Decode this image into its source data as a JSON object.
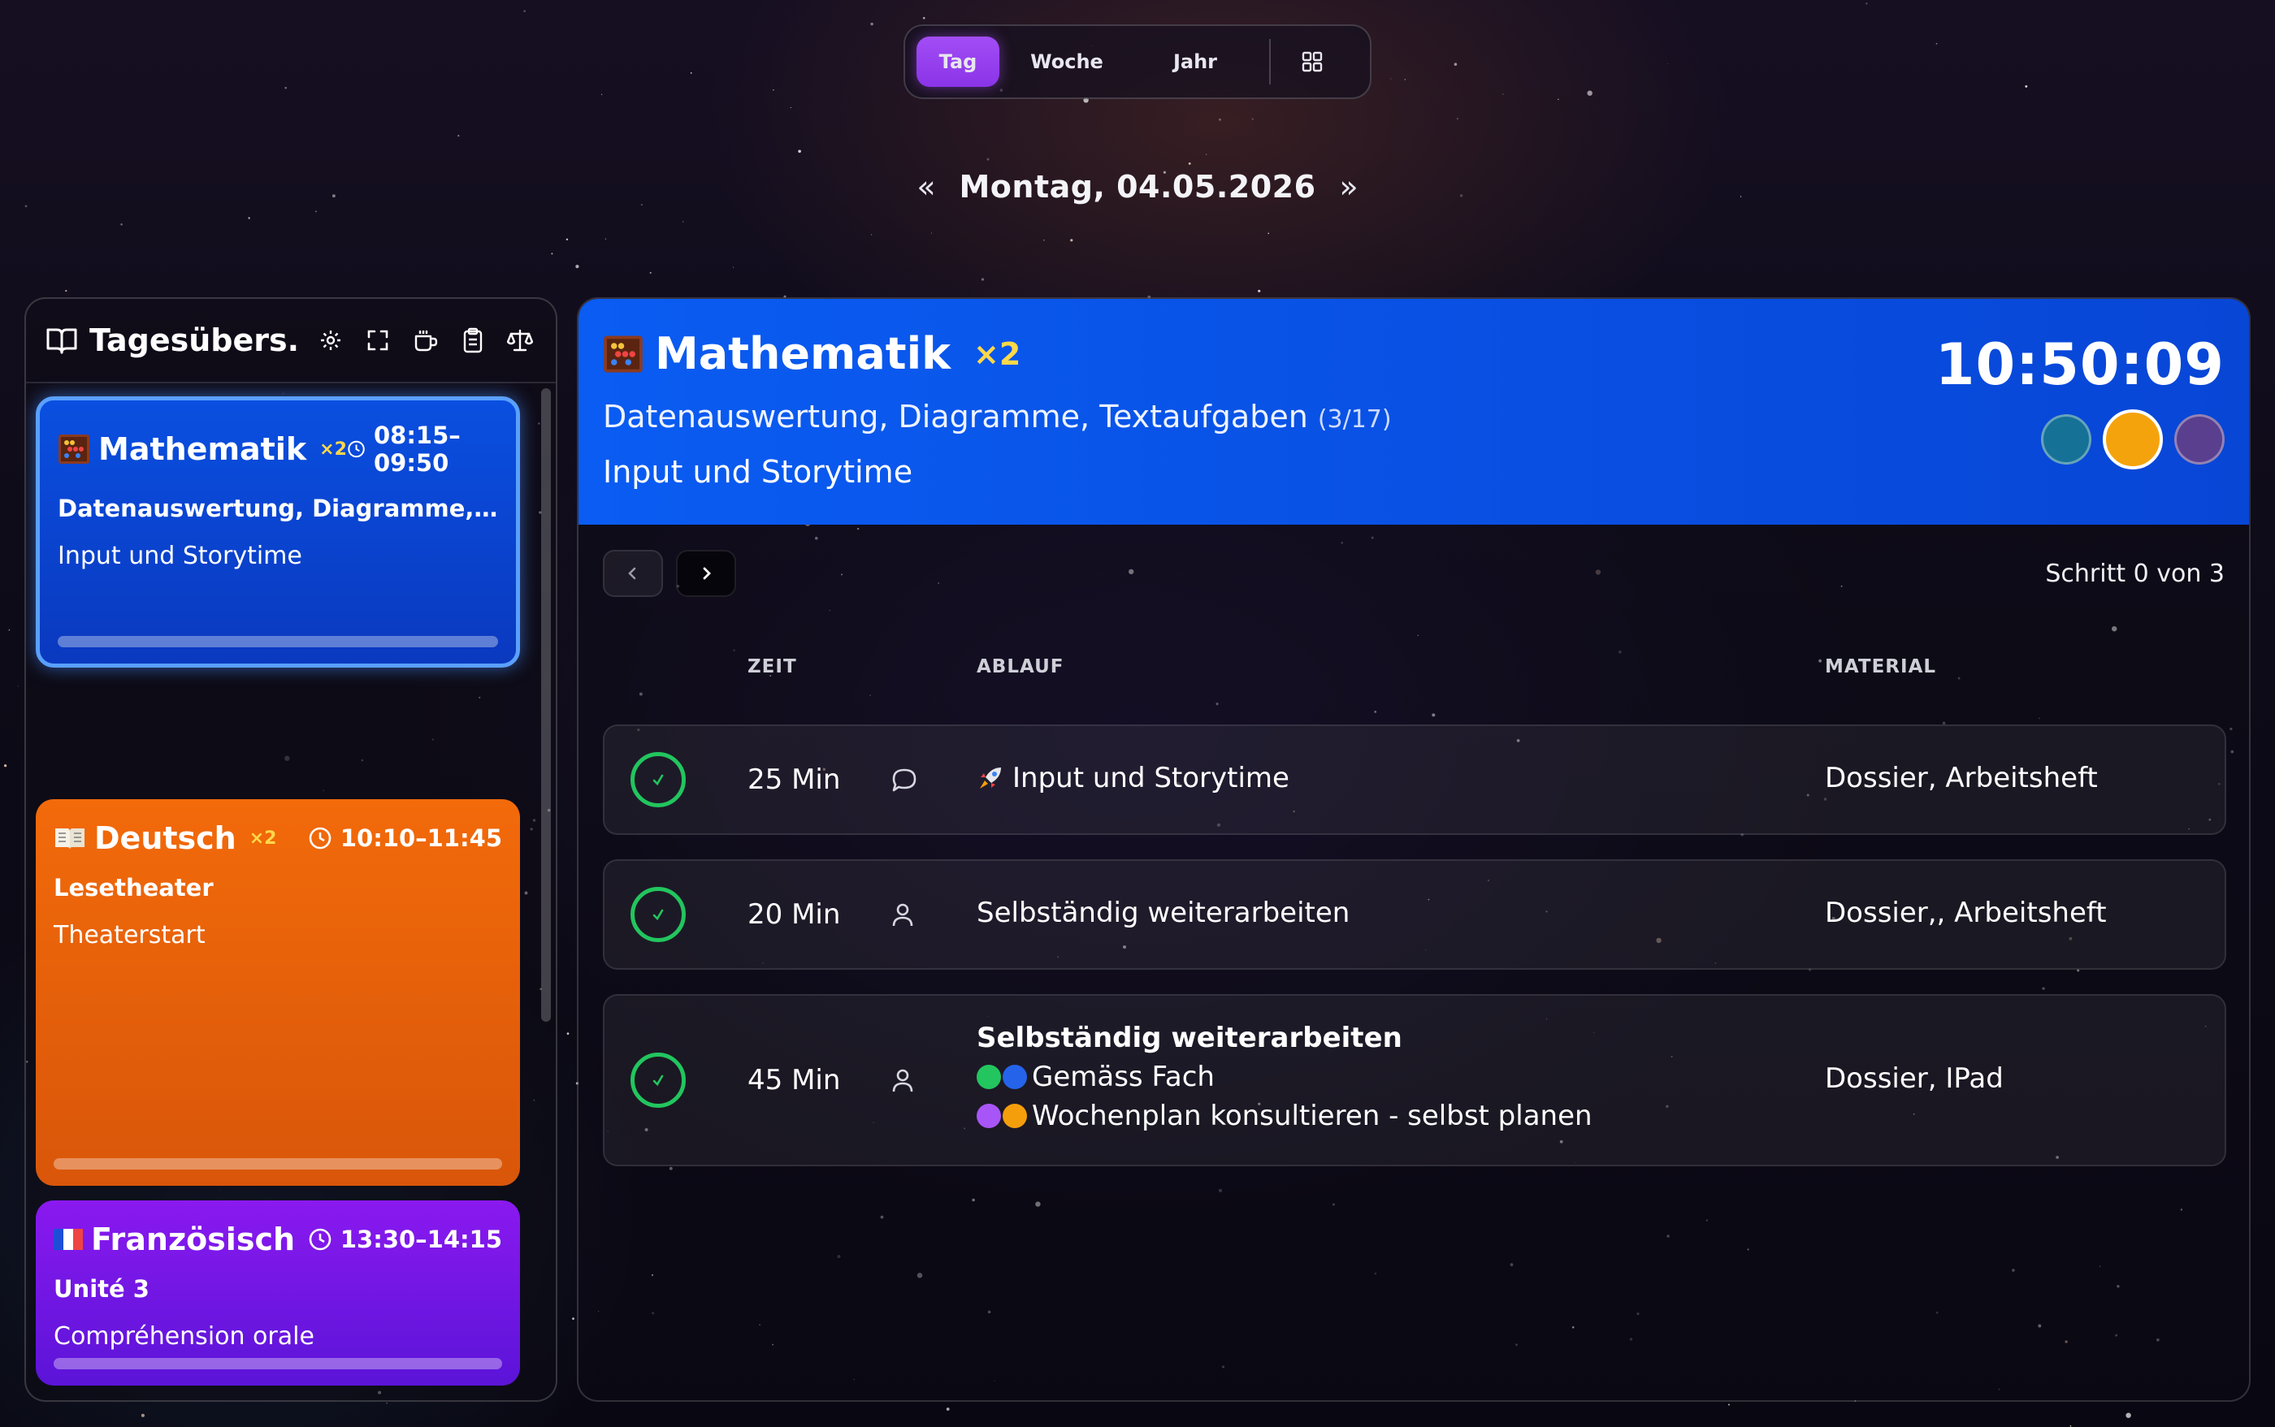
{
  "view_switcher": {
    "tabs": [
      {
        "label": "Tag",
        "active": true
      },
      {
        "label": "Woche",
        "active": false
      },
      {
        "label": "Jahr",
        "active": false
      }
    ],
    "grid_icon": "grid-icon"
  },
  "date_nav": {
    "prev": "«",
    "label": "Montag, 04.05.2026",
    "next": "»"
  },
  "left_panel": {
    "title": "Tagesübers...",
    "header_icons": [
      "book-open-icon",
      "gear-icon",
      "fullscreen-icon",
      "coffee-icon",
      "clipboard-icon",
      "scale-icon"
    ],
    "lessons": [
      {
        "subject": "Mathematik",
        "multiplier": "×2",
        "time": "08:15–09:50",
        "topic": "Datenauswertung, Diagramme, Text...",
        "subtopic": "Input und Storytime",
        "color": "#0a47d6",
        "icon": "abacus-icon"
      },
      {
        "subject": "Deutsch",
        "multiplier": "×2",
        "time": "10:10–11:45",
        "topic": "Lesetheater",
        "subtopic": "Theaterstart",
        "color": "#e8600a",
        "icon": "open-book-icon"
      },
      {
        "subject": "Französisch",
        "multiplier": "",
        "time": "13:30–14:15",
        "topic": "Unité 3",
        "subtopic": "Compréhension orale",
        "color": "#7216e6",
        "icon": "french-flag-icon"
      }
    ]
  },
  "current": {
    "subject": "Mathematik",
    "multiplier": "×2",
    "topic": "Datenauswertung, Diagramme, Textaufgaben",
    "count": "(3/17)",
    "subtopic": "Input und Storytime",
    "clock": "10:50:09",
    "status_dots": [
      "#157296",
      "#f5a30c",
      "#5a3f8e"
    ]
  },
  "steps": {
    "label": "Schritt 0 von 3",
    "prev_icon": "chevron-left-icon",
    "next_icon": "chevron-right-icon"
  },
  "table": {
    "headers": {
      "zeit": "ZEIT",
      "ablauf": "ABLAUF",
      "material": "MATERIAL"
    },
    "rows": [
      {
        "minutes": "25 Min",
        "mode_icon": "speech-bubble-icon",
        "flow_title": "",
        "flow_lines": [
          "Input und Storytime"
        ],
        "material": "Dossier, Arbeitsheft"
      },
      {
        "minutes": "20 Min",
        "mode_icon": "person-icon",
        "flow_title": "",
        "flow_lines": [
          "Selbständig weiterarbeiten"
        ],
        "material": "Dossier,, Arbeitsheft"
      },
      {
        "minutes": "45 Min",
        "mode_icon": "person-icon",
        "flow_title": "Selbständig weiterarbeiten",
        "flow_lines": [
          "Gemäss Fach",
          "Wochenplan konsultieren - selbst planen"
        ],
        "material": "Dossier, IPad"
      }
    ]
  }
}
